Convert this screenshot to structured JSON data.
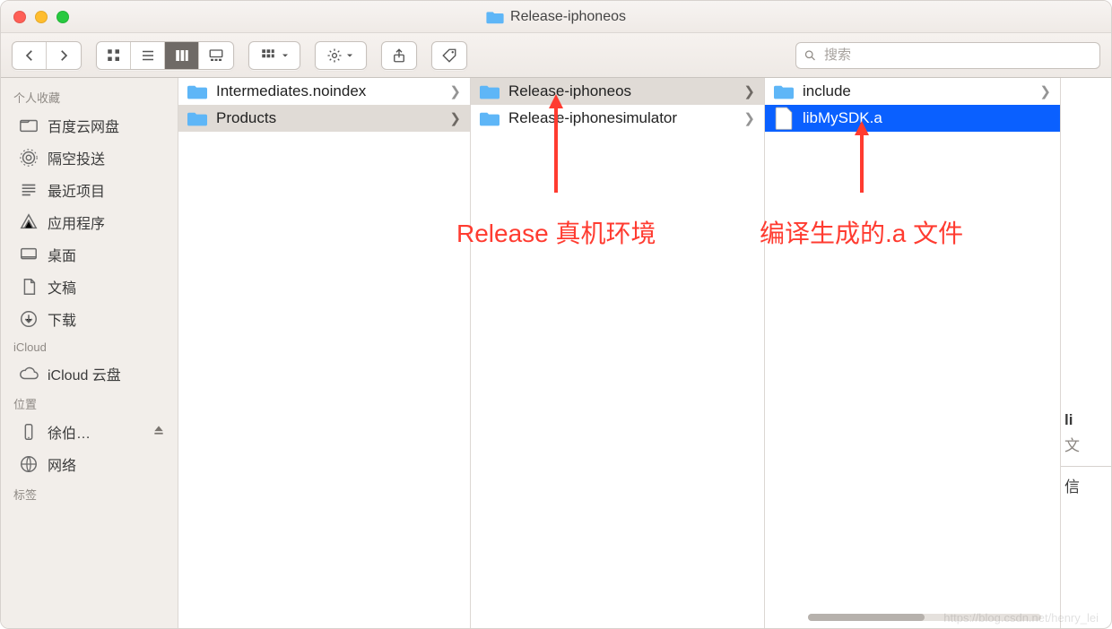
{
  "titlebar": {
    "title": "Release-iphoneos"
  },
  "toolbar": {
    "search_placeholder": "搜索"
  },
  "sidebar": {
    "sections": [
      {
        "label": "个人收藏",
        "items": [
          {
            "icon": "folder",
            "label": "百度云网盘"
          },
          {
            "icon": "airdrop",
            "label": "隔空投送"
          },
          {
            "icon": "recents",
            "label": "最近项目"
          },
          {
            "icon": "apps",
            "label": "应用程序"
          },
          {
            "icon": "desktop",
            "label": "桌面"
          },
          {
            "icon": "docs",
            "label": "文稿"
          },
          {
            "icon": "downloads",
            "label": "下载"
          }
        ]
      },
      {
        "label": "iCloud",
        "items": [
          {
            "icon": "cloud",
            "label": "iCloud 云盘"
          }
        ]
      },
      {
        "label": "位置",
        "items": [
          {
            "icon": "iphone",
            "label": "徐伯…",
            "eject": true
          },
          {
            "icon": "network",
            "label": "网络"
          }
        ]
      },
      {
        "label": "标签",
        "items": []
      }
    ]
  },
  "columns": [
    {
      "items": [
        {
          "icon": "folder",
          "label": "Intermediates.noindex",
          "hasChildren": true,
          "pathSelected": false,
          "finalSelected": false
        },
        {
          "icon": "folder",
          "label": "Products",
          "hasChildren": true,
          "pathSelected": true,
          "finalSelected": false
        }
      ]
    },
    {
      "items": [
        {
          "icon": "folder",
          "label": "Release-iphoneos",
          "hasChildren": true,
          "pathSelected": true,
          "finalSelected": false
        },
        {
          "icon": "folder",
          "label": "Release-iphonesimulator",
          "hasChildren": true,
          "pathSelected": false,
          "finalSelected": false
        }
      ]
    },
    {
      "items": [
        {
          "icon": "folder",
          "label": "include",
          "hasChildren": true,
          "pathSelected": false,
          "finalSelected": false
        },
        {
          "icon": "file",
          "label": "libMySDK.a",
          "hasChildren": false,
          "pathSelected": false,
          "finalSelected": true
        }
      ]
    }
  ],
  "preview": {
    "line1": "li",
    "line2": "文",
    "line3": "信"
  },
  "annotations": {
    "a1": "Release 真机环境",
    "a2": "编译生成的.a 文件"
  },
  "watermark": "https://blog.csdn.net/henry_lei"
}
